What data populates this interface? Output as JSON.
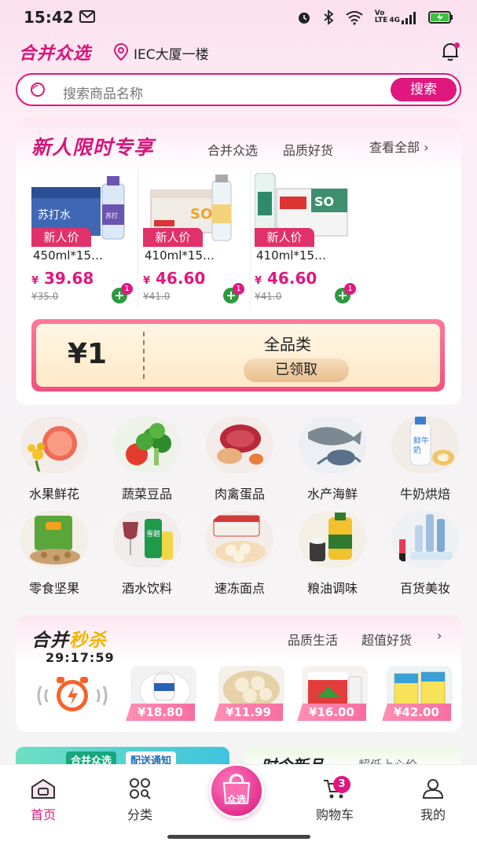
{
  "status_bar": {
    "time": "15:42",
    "volte": "Vo\nLTE",
    "network": "4G"
  },
  "header": {
    "brand": "合并众选",
    "location": "IEC大厦一楼"
  },
  "search": {
    "placeholder": "搜索商品名称",
    "button": "搜索"
  },
  "new_user": {
    "title": "新人限时专享",
    "sub1": "合并众选",
    "sub2": "品质好货",
    "view_all": "查看全部",
    "products": [
      {
        "tag": "新人价",
        "name": "450ml*15…",
        "price_symbol": "¥",
        "price": "39.68",
        "old_price": "¥35.0",
        "cart_count": "1"
      },
      {
        "tag": "新人价",
        "name": "410ml*15…",
        "price_symbol": "¥",
        "price": "46.60",
        "old_price": "¥41.0",
        "cart_count": "1"
      },
      {
        "tag": "新人价",
        "name": "410ml*15…",
        "price_symbol": "¥",
        "price": "46.60",
        "old_price": "¥41.0",
        "cart_count": "1"
      }
    ],
    "coupon": {
      "value": "¥1",
      "label": "全品类",
      "button": "已领取"
    }
  },
  "categories": [
    {
      "label": "水果鲜花",
      "icon": "fruit-flower-icon"
    },
    {
      "label": "蔬菜豆品",
      "icon": "vegetable-icon"
    },
    {
      "label": "肉禽蛋品",
      "icon": "meat-icon"
    },
    {
      "label": "水产海鲜",
      "icon": "seafood-icon"
    },
    {
      "label": "牛奶烘焙",
      "icon": "milk-bakery-icon"
    },
    {
      "label": "零食坚果",
      "icon": "snack-icon"
    },
    {
      "label": "酒水饮料",
      "icon": "drinks-icon"
    },
    {
      "label": "速冻面点",
      "icon": "frozen-food-icon"
    },
    {
      "label": "粮油调味",
      "icon": "grain-oil-icon"
    },
    {
      "label": "百货美妆",
      "icon": "cosmetics-icon"
    }
  ],
  "flash_sale": {
    "title_a": "合并",
    "title_b": "秒杀",
    "timer": "29:17:59",
    "sub1": "品质生活",
    "sub2": "超值好货",
    "items": [
      {
        "price": "¥18.80"
      },
      {
        "price": "¥11.99"
      },
      {
        "price": "¥16.00"
      },
      {
        "price": "¥42.00"
      }
    ]
  },
  "promo": {
    "left_tag": "合并众选",
    "left_tag2": "配送通知",
    "right_title": "时令新品",
    "right_sub": "超低上心价"
  },
  "tabbar": {
    "home": "首页",
    "category": "分类",
    "center": "众选",
    "cart": "购物车",
    "cart_badge": "3",
    "mine": "我的"
  },
  "colors": {
    "accent": "#e0177f",
    "brand": "#d8137a",
    "green": "#2b9a3c"
  }
}
